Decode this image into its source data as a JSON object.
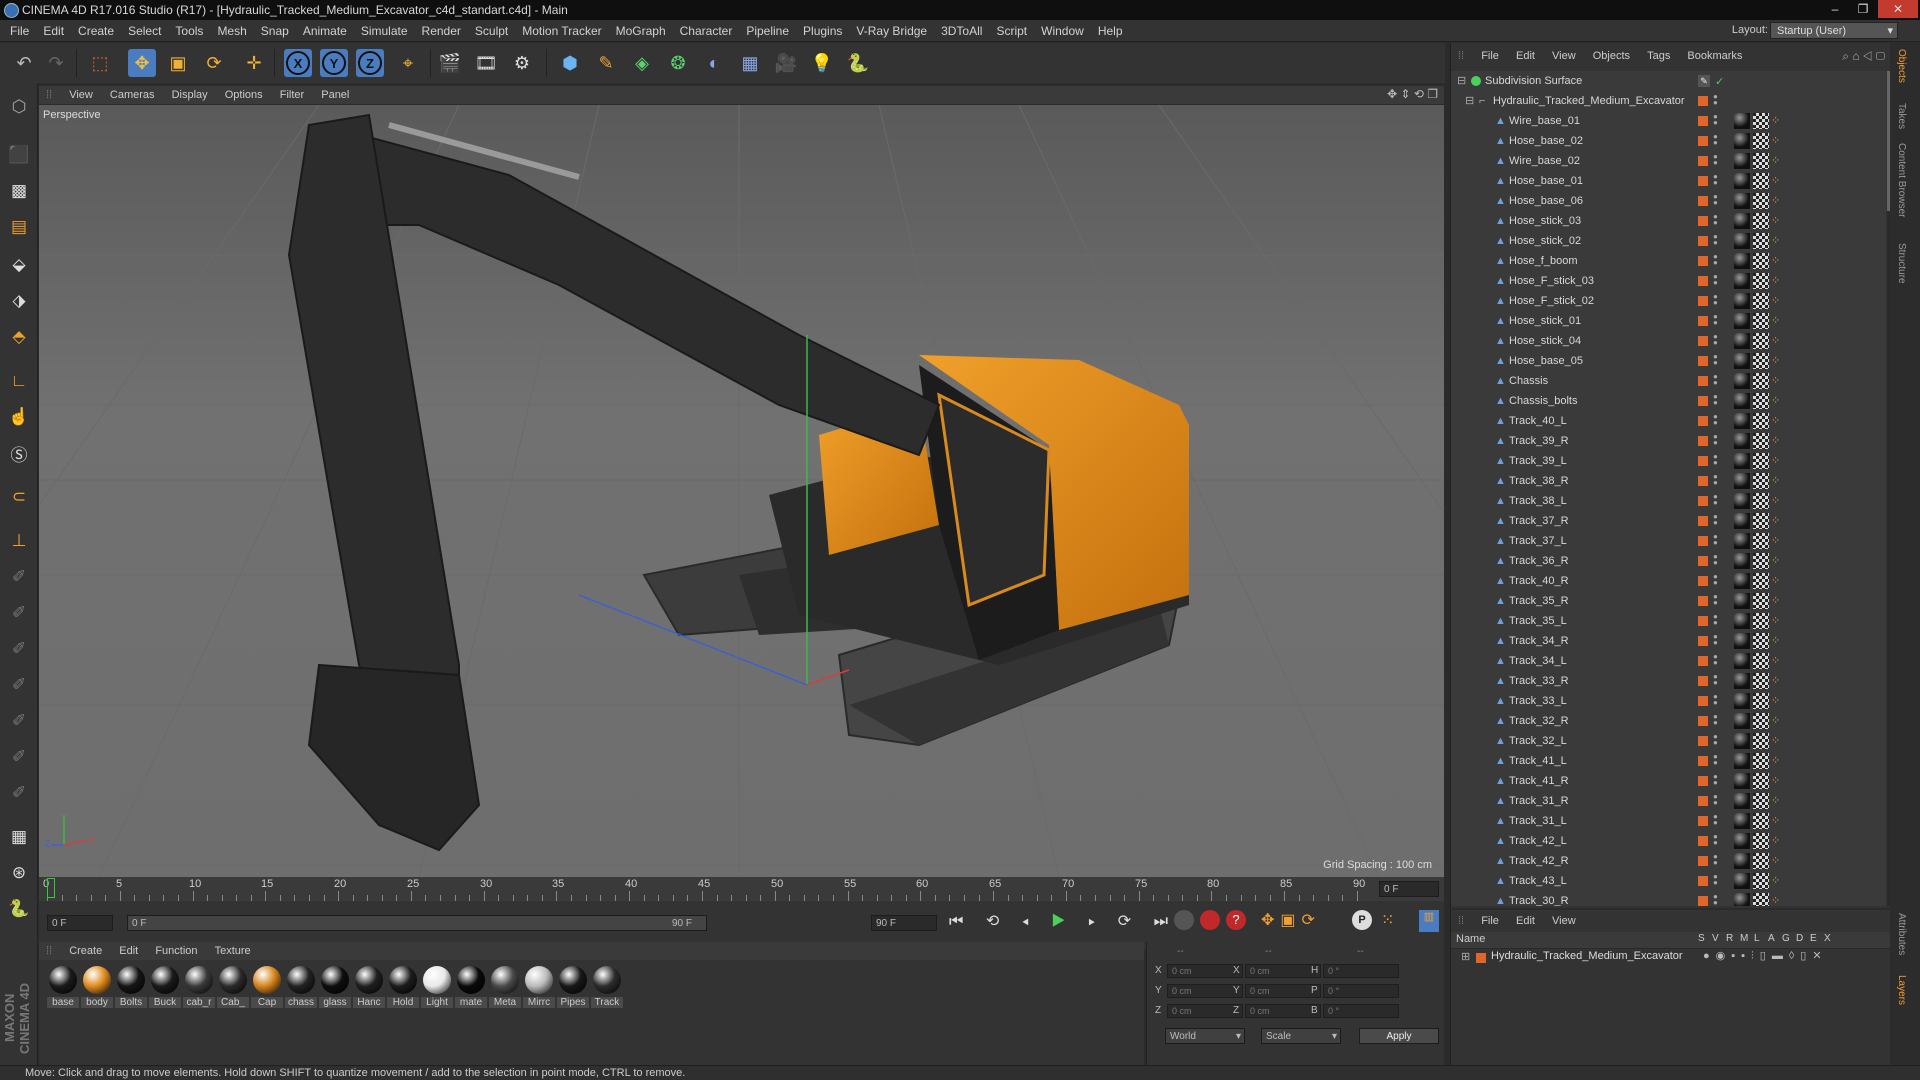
{
  "window": {
    "title": "CINEMA 4D R17.016 Studio (R17) - [Hydraulic_Tracked_Medium_Excavator_c4d_standart.c4d] - Main",
    "controls": [
      "–",
      "❐",
      "✕"
    ]
  },
  "menubar": {
    "items": [
      "File",
      "Edit",
      "Create",
      "Select",
      "Tools",
      "Mesh",
      "Snap",
      "Animate",
      "Simulate",
      "Render",
      "Sculpt",
      "Motion Tracker",
      "MoGraph",
      "Character",
      "Pipeline",
      "Plugins",
      "V-Ray Bridge",
      "3DToAll",
      "Script",
      "Window",
      "Help"
    ],
    "layout_label": "Layout:",
    "layout_value": "Startup (User)"
  },
  "toolbar": {
    "icons": [
      "undo-icon",
      "redo-icon",
      "live-selection-icon",
      "move-icon",
      "scale-icon",
      "rotate-icon",
      "create-icon",
      "x-axis-icon",
      "y-axis-icon",
      "z-axis-icon",
      "coordinate-system-icon",
      "render-view-icon",
      "render-picture-viewer-icon",
      "edit-render-settings-icon",
      "cube-icon",
      "pen-spline-icon",
      "subdivision-icon",
      "array-icon",
      "deformer-icon",
      "floor-icon",
      "camera-icon",
      "light-icon",
      "python-icon"
    ],
    "axis_labels": [
      "X",
      "Y",
      "Z"
    ]
  },
  "viewport": {
    "menu": [
      "View",
      "Cameras",
      "Display",
      "Options",
      "Filter",
      "Panel"
    ],
    "label": "Perspective",
    "grid_spacing": "Grid Spacing : 100 cm",
    "axis_labels": [
      "Y",
      "Z",
      "X"
    ]
  },
  "timeline": {
    "ticks": [
      "0",
      "5",
      "10",
      "15",
      "20",
      "25",
      "30",
      "35",
      "40",
      "45",
      "50",
      "55",
      "60",
      "65",
      "70",
      "75",
      "80",
      "85",
      "90"
    ],
    "end_frame": "0 F"
  },
  "animbar": {
    "current_frame": "0 F",
    "range_start": "0 F",
    "range_end": "90 F",
    "max_frame": "90 F"
  },
  "material_manager": {
    "menu": [
      "Create",
      "Edit",
      "Function",
      "Texture"
    ],
    "materials": [
      {
        "label": "base",
        "color": "#1a1a1a"
      },
      {
        "label": "body",
        "color": "#e08a1e"
      },
      {
        "label": "Bolts",
        "color": "#151515"
      },
      {
        "label": "Buck",
        "color": "#1a1a1a"
      },
      {
        "label": "cab_r",
        "color": "#3a3a3a"
      },
      {
        "label": "Cab_",
        "color": "#2a2a2a"
      },
      {
        "label": "Cap",
        "color": "#d4841c"
      },
      {
        "label": "chass",
        "color": "#222222"
      },
      {
        "label": "glass",
        "color": "#0e0e0e"
      },
      {
        "label": "Hanc",
        "color": "#202020"
      },
      {
        "label": "Hold",
        "color": "#1c1c1c"
      },
      {
        "label": "Light",
        "color": "#e8e8e8"
      },
      {
        "label": "mate",
        "color": "#0a0a0a"
      },
      {
        "label": "Meta",
        "color": "#4a4a4a"
      },
      {
        "label": "Mirrc",
        "color": "#bbbbbb"
      },
      {
        "label": "Pipes",
        "color": "#181818"
      },
      {
        "label": "Track",
        "color": "#2c2c2c"
      }
    ]
  },
  "coord_manager": {
    "header": [
      "--",
      "--",
      "--"
    ],
    "rows": [
      {
        "a": "X",
        "av": "0 cm",
        "b": "X",
        "bv": "0 cm",
        "c": "H",
        "cv": "0 °"
      },
      {
        "a": "Y",
        "av": "0 cm",
        "b": "Y",
        "bv": "0 cm",
        "c": "P",
        "cv": "0 °"
      },
      {
        "a": "Z",
        "av": "0 cm",
        "b": "Z",
        "bv": "0 cm",
        "c": "B",
        "cv": "0 °"
      }
    ],
    "mode1": "World",
    "mode2": "Scale",
    "apply": "Apply"
  },
  "object_manager": {
    "menu": [
      "File",
      "Edit",
      "View",
      "Objects",
      "Tags",
      "Bookmarks"
    ],
    "root": "Subdivision Surface",
    "group": "Hydraulic_Tracked_Medium_Excavator",
    "objects": [
      "Wire_base_01",
      "Hose_base_02",
      "Wire_base_02",
      "Hose_base_01",
      "Hose_base_06",
      "Hose_stick_03",
      "Hose_stick_02",
      "Hose_f_boom",
      "Hose_F_stick_03",
      "Hose_F_stick_02",
      "Hose_stick_01",
      "Hose_stick_04",
      "Hose_base_05",
      "Chassis",
      "Chassis_bolts",
      "Track_40_L",
      "Track_39_R",
      "Track_39_L",
      "Track_38_R",
      "Track_38_L",
      "Track_37_R",
      "Track_37_L",
      "Track_36_R",
      "Track_40_R",
      "Track_35_R",
      "Track_35_L",
      "Track_34_R",
      "Track_34_L",
      "Track_33_R",
      "Track_33_L",
      "Track_32_R",
      "Track_32_L",
      "Track_41_L",
      "Track_41_R",
      "Track_31_R",
      "Track_31_L",
      "Track_42_L",
      "Track_42_R",
      "Track_43_L",
      "Track_30_R"
    ]
  },
  "layer_manager": {
    "menu": [
      "File",
      "Edit",
      "View"
    ],
    "name_header": "Name",
    "flags": [
      "S",
      "V",
      "R",
      "M",
      "L",
      "A",
      "G",
      "D",
      "E",
      "X"
    ],
    "layer_name": "Hydraulic_Tracked_Medium_Excavator"
  },
  "side_tabs": [
    "Objects",
    "Takes",
    "Content Browser",
    "Structure",
    "Attributes",
    "Layers"
  ],
  "brand": "MAXON CINEMA 4D",
  "status": "Move: Click and drag to move elements. Hold down SHIFT to quantize movement / add to the selection in point mode, CTRL to remove.",
  "colors": {
    "accent": "#e0662a",
    "selection": "#4a7dbf",
    "body_orange": "#e08a1e"
  }
}
